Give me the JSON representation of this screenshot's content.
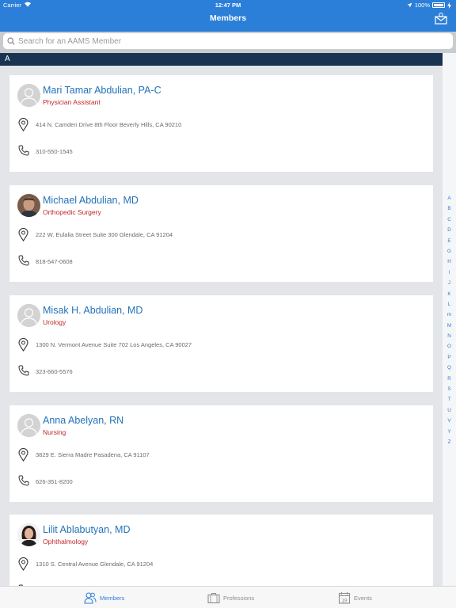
{
  "status": {
    "carrier": "Carrier",
    "time": "12:47 PM",
    "battery": "100%"
  },
  "nav": {
    "title": "Members",
    "action_icon": "mail-inbox-icon"
  },
  "search": {
    "placeholder": "Search for an AAMS Member",
    "value": ""
  },
  "section": {
    "letter": "A"
  },
  "members": [
    {
      "name": "Mari Tamar Abdulian, PA-C",
      "profession": "Physician Assistant",
      "address": "414 N. Camden Drive 8th Floor Beverly Hills, CA 90210",
      "phone": "310-550-1545",
      "avatar": "default"
    },
    {
      "name": "Michael Abdulian, MD",
      "profession": "Orthopedic Surgery",
      "address": "222 W. Eulalia Street Suite 300 Glendale, CA 91204",
      "phone": "818-547-0608",
      "avatar": "photo-male"
    },
    {
      "name": "Misak H. Abdulian, MD",
      "profession": "Urology",
      "address": "1300 N. Vermont Avenue Suite 702 Los Angeles, CA 90027",
      "phone": "323-660-5576",
      "avatar": "default"
    },
    {
      "name": "Anna Abelyan, RN",
      "profession": "Nursing",
      "address": "3829 E. Sierra Madre Pasadena, CA 91107",
      "phone": "626-351-8200",
      "avatar": "default"
    },
    {
      "name": "Lilit Ablabutyan, MD",
      "profession": "Ophthalmology",
      "address": "1310 S. Central Avenue Glendale, CA 91204",
      "phone": "",
      "avatar": "photo-female"
    }
  ],
  "index_letters": [
    "A",
    "B",
    "C",
    "D",
    "E",
    "G",
    "H",
    "I",
    "J",
    "K",
    "L",
    "m",
    "M",
    "N",
    "O",
    "P",
    "Q",
    "R",
    "S",
    "T",
    "U",
    "V",
    "Y",
    "Z"
  ],
  "tabs": [
    {
      "label": "Members",
      "icon": "members-icon",
      "active": true
    },
    {
      "label": "Professions",
      "icon": "briefcase-icon",
      "active": false
    },
    {
      "label": "Events",
      "icon": "calendar-icon",
      "active": false,
      "icon_text": "19"
    }
  ],
  "colors": {
    "nav": "#2c7fd8",
    "section_header": "#1a3352",
    "name": "#2373b9",
    "profession": "#c0272d"
  }
}
